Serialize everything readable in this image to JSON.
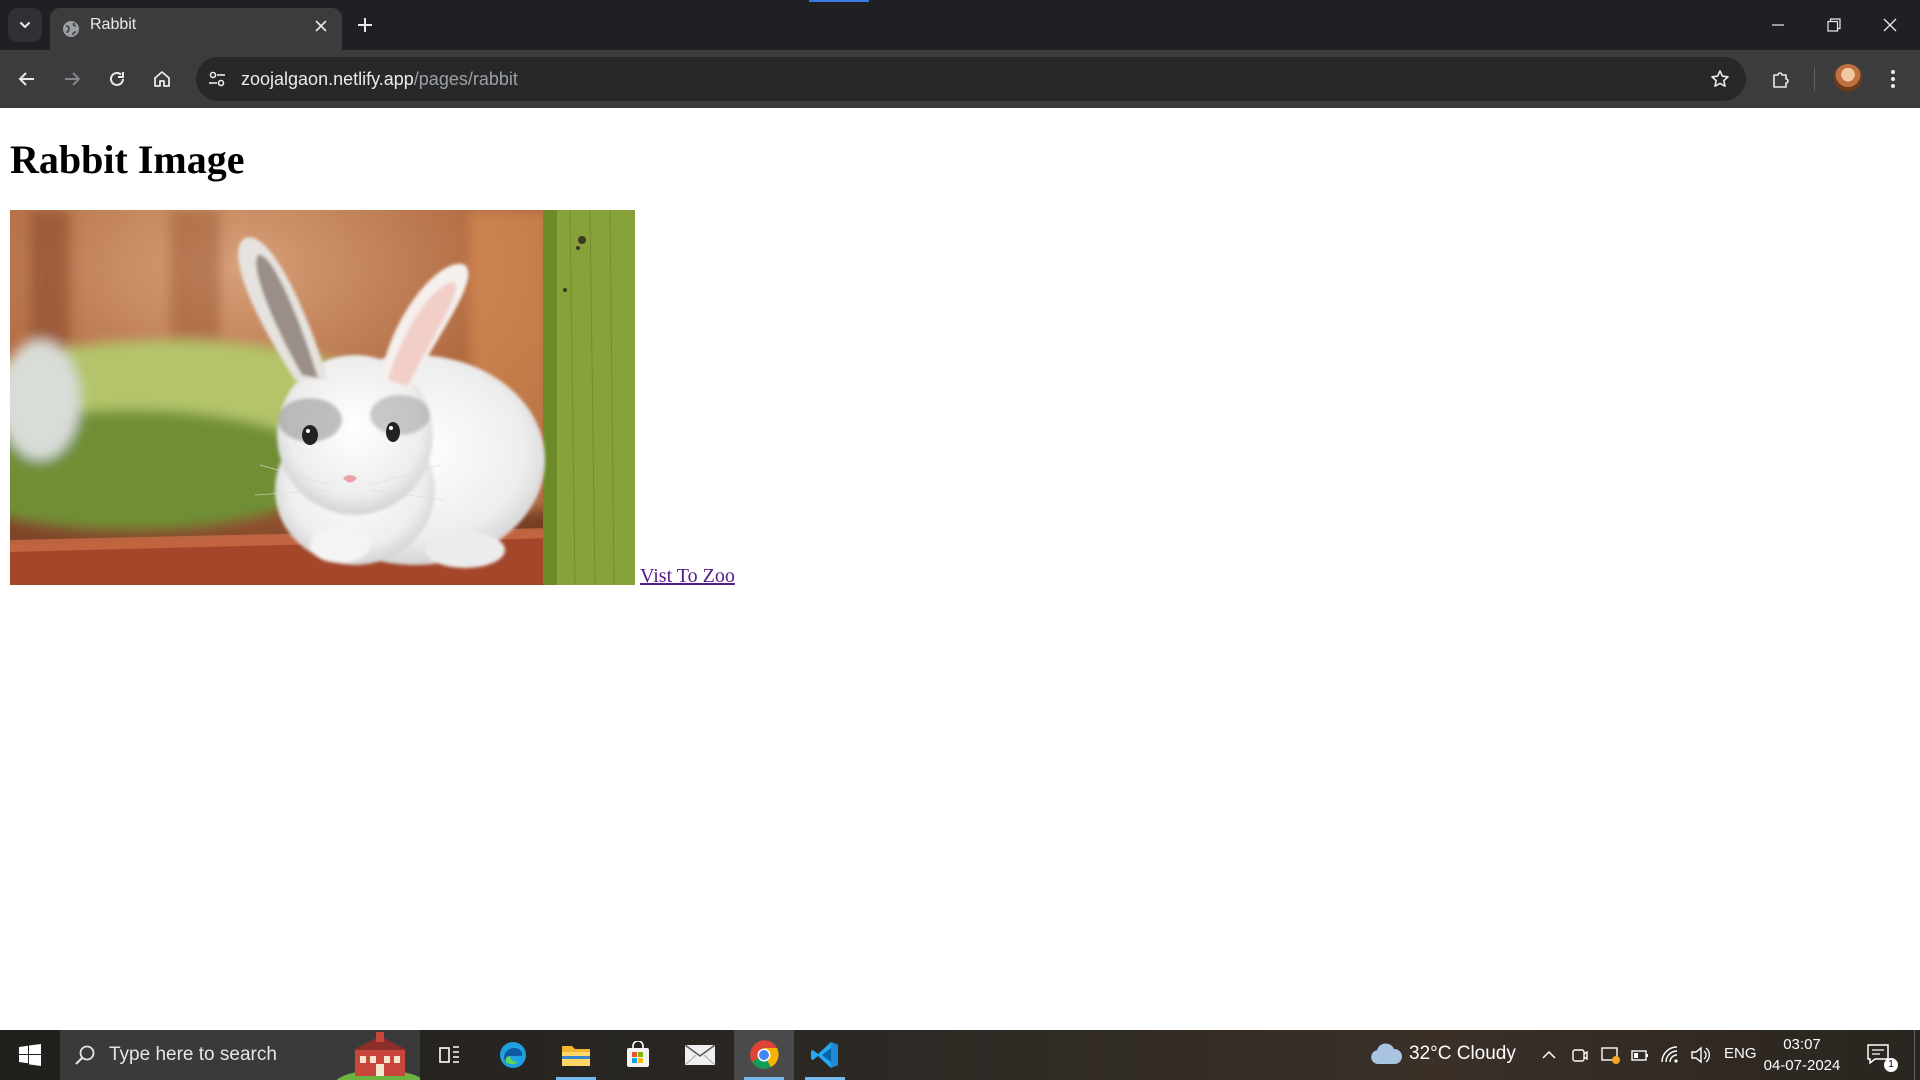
{
  "browser": {
    "tab_title": "Rabbit",
    "url_host": "zoojalgaon.netlify.app",
    "url_path": "/pages/rabbit"
  },
  "page": {
    "heading": "Rabbit Image",
    "link_text": "Vist To Zoo"
  },
  "taskbar": {
    "search_placeholder": "Type here to search",
    "weather": "32°C  Cloudy",
    "language": "ENG",
    "time": "03:07",
    "date": "04-07-2024",
    "notification_count": "1"
  }
}
